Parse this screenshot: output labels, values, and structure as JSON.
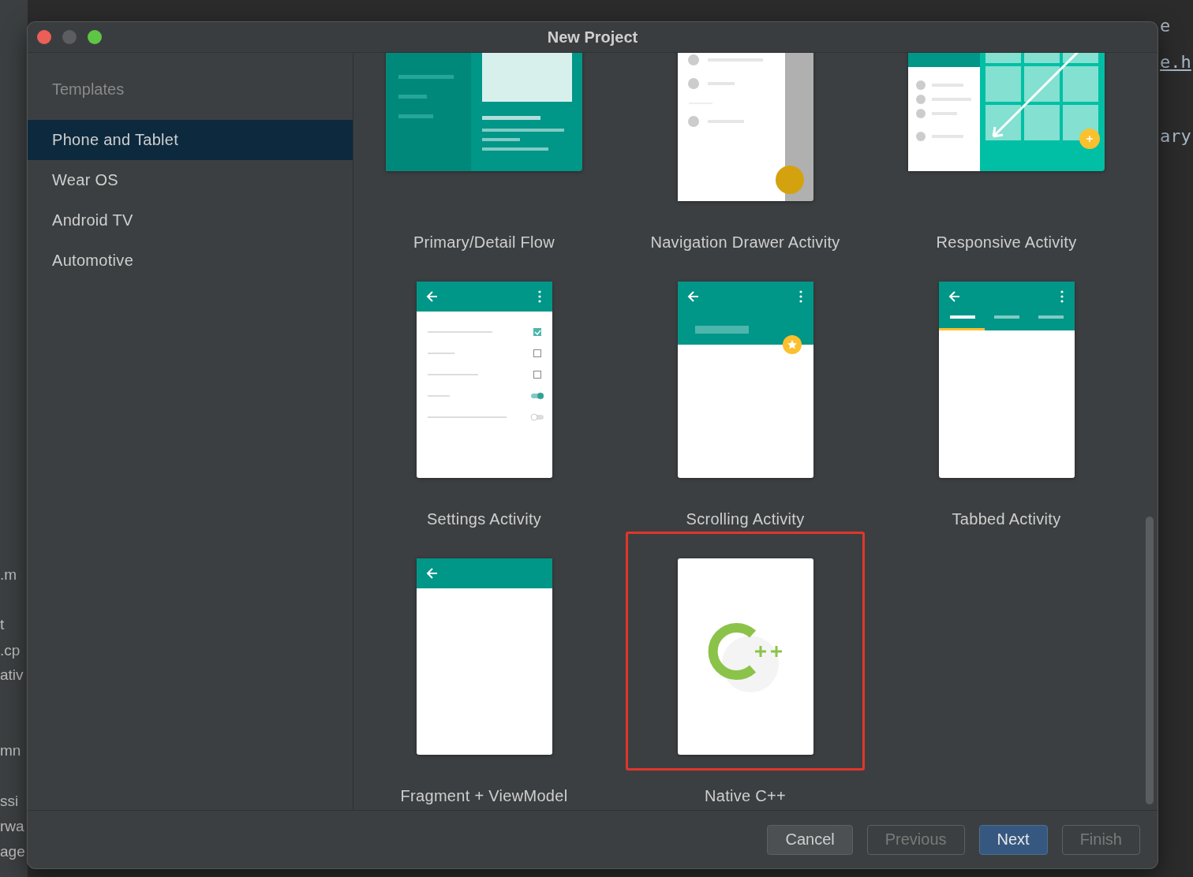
{
  "background_editor": {
    "left_fragments": [
      ".m",
      "t",
      ".cp",
      "ativ",
      "mn",
      "ssi",
      "rwa",
      "age"
    ],
    "right_fragments": [
      "e",
      "e.h",
      "ary"
    ]
  },
  "window": {
    "title": "New Project"
  },
  "sidebar": {
    "heading": "Templates",
    "items": [
      {
        "label": "Phone and Tablet",
        "selected": true
      },
      {
        "label": "Wear OS",
        "selected": false
      },
      {
        "label": "Android TV",
        "selected": false
      },
      {
        "label": "Automotive",
        "selected": false
      }
    ]
  },
  "templates": [
    {
      "kind": "primary-detail",
      "label": "Primary/Detail Flow",
      "selected": false
    },
    {
      "kind": "nav-drawer",
      "label": "Navigation Drawer Activity",
      "selected": false
    },
    {
      "kind": "responsive",
      "label": "Responsive Activity",
      "selected": false
    },
    {
      "kind": "settings",
      "label": "Settings Activity",
      "selected": false
    },
    {
      "kind": "scrolling",
      "label": "Scrolling Activity",
      "selected": false
    },
    {
      "kind": "tabbed",
      "label": "Tabbed Activity",
      "selected": false
    },
    {
      "kind": "fragment",
      "label": "Fragment + ViewModel",
      "selected": false
    },
    {
      "kind": "native-cpp",
      "label": "Native C++",
      "selected": true
    }
  ],
  "buttons": [
    {
      "label": "Cancel",
      "primary": false,
      "disabled": false
    },
    {
      "label": "Previous",
      "primary": false,
      "disabled": true
    },
    {
      "label": "Next",
      "primary": true,
      "disabled": false
    },
    {
      "label": "Finish",
      "primary": false,
      "disabled": true
    }
  ]
}
